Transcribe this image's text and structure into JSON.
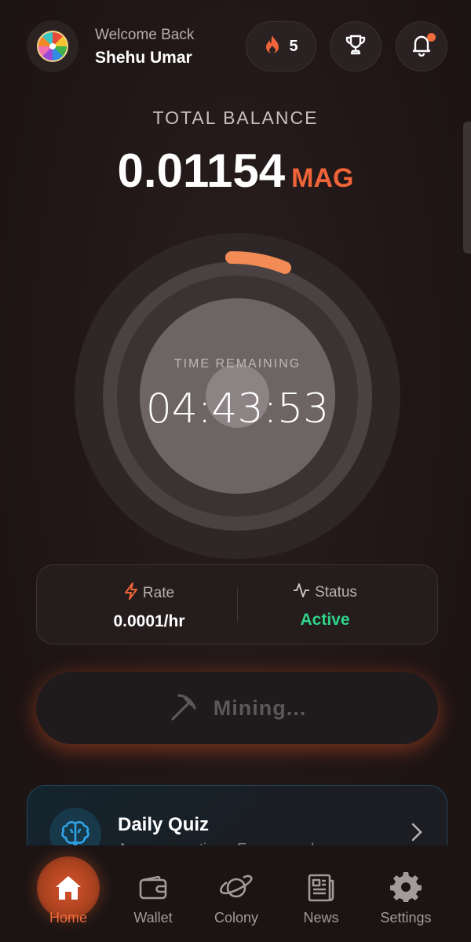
{
  "header": {
    "welcome_label": "Welcome Back",
    "user_name": "Shehu Umar",
    "streak_count": "5",
    "avatar_icon": "prize-wheel-icon",
    "streak_icon": "flame-icon",
    "trophy_icon": "trophy-icon",
    "bell_icon": "bell-icon",
    "notification_dot_color": "#f26b3a"
  },
  "balance": {
    "label": "TOTAL BALANCE",
    "value": "0.01154",
    "unit": "MAG"
  },
  "timer": {
    "label": "TIME REMAINING",
    "value": "04:43:53",
    "progress_color": "#f28b55"
  },
  "stats": {
    "rate": {
      "label": "Rate",
      "value": "0.0001/hr",
      "icon": "lightning-icon"
    },
    "status": {
      "label": "Status",
      "value": "Active",
      "icon": "activity-icon",
      "color": "#2fd58a"
    }
  },
  "mining_button": {
    "label": "Mining...",
    "icon": "pickaxe-icon"
  },
  "quiz_card": {
    "title": "Daily Quiz",
    "subtitle": "Answer questions. Earn rewards.",
    "icon": "brain-icon"
  },
  "nav": {
    "items": [
      {
        "label": "Home",
        "icon": "home-icon",
        "active": true
      },
      {
        "label": "Wallet",
        "icon": "wallet-icon",
        "active": false
      },
      {
        "label": "Colony",
        "icon": "planet-icon",
        "active": false
      },
      {
        "label": "News",
        "icon": "newspaper-icon",
        "active": false
      },
      {
        "label": "Settings",
        "icon": "gear-icon",
        "active": false
      }
    ]
  },
  "colors": {
    "accent": "#f0643a",
    "background": "#201616"
  }
}
